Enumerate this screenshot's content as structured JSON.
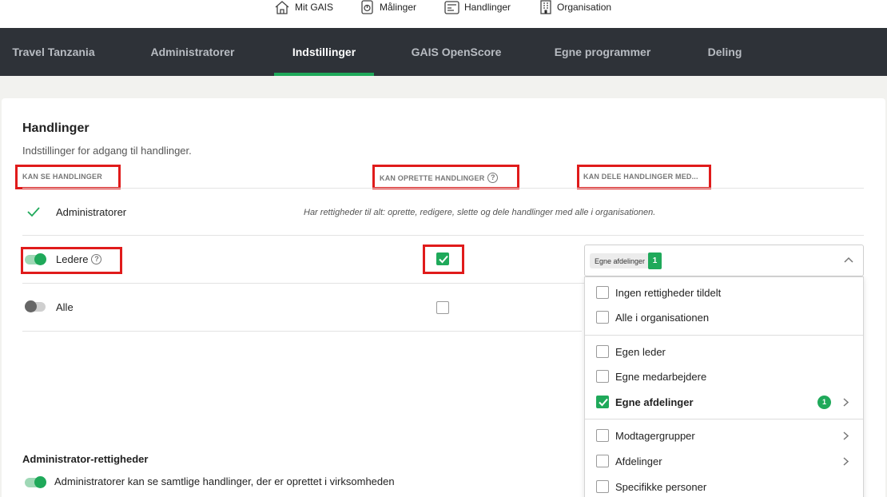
{
  "topnav": [
    {
      "label": "Mit GAIS",
      "icon": "home-icon"
    },
    {
      "label": "Målinger",
      "icon": "survey-icon"
    },
    {
      "label": "Handlinger",
      "icon": "actions-icon"
    },
    {
      "label": "Organisation",
      "icon": "building-icon"
    }
  ],
  "tabs": [
    {
      "label": "Travel Tanzania"
    },
    {
      "label": "Administratorer"
    },
    {
      "label": "Indstillinger",
      "active": true
    },
    {
      "label": "GAIS OpenScore"
    },
    {
      "label": "Egne programmer"
    },
    {
      "label": "Deling"
    }
  ],
  "section": {
    "title": "Handlinger",
    "subtitle": "Indstillinger for adgang til handlinger."
  },
  "columns": {
    "see": "KAN SE HANDLINGER",
    "create": "KAN OPRETTE HANDLINGER",
    "share": "KAN DELE HANDLINGER MED..."
  },
  "rows": {
    "admins": {
      "label": "Administratorer",
      "note": "Har rettigheder til alt: oprette, redigere, slette og dele handlinger med alle i organisationen."
    },
    "leaders": {
      "label": "Ledere",
      "enabled": true,
      "can_create": true
    },
    "all": {
      "label": "Alle",
      "enabled": false,
      "can_create": false
    }
  },
  "help_glyph": "?",
  "share_dropdown": {
    "selected_chip": "Egne afdelinger",
    "selected_count": "1",
    "options": [
      {
        "label": "Ingen rettigheder tildelt",
        "checked": false
      },
      {
        "label": "Alle i organisationen",
        "checked": false
      },
      {
        "label": "Egen leder",
        "checked": false
      },
      {
        "label": "Egne medarbejdere",
        "checked": false
      },
      {
        "label": "Egne afdelinger",
        "checked": true,
        "badge": "1"
      },
      {
        "label": "Modtagergrupper",
        "checked": false
      },
      {
        "label": "Afdelinger",
        "checked": false
      },
      {
        "label": "Specifikke personer",
        "checked": false
      }
    ]
  },
  "admin_rights": {
    "title": "Administrator-rettigheder",
    "option": "Administratorer kan se samtlige handlinger, der er oprettet i virksomheden",
    "enabled": true
  },
  "colors": {
    "accent": "#1fa95a",
    "tabbar": "#2e3238",
    "highlight": "#e01b1b"
  }
}
